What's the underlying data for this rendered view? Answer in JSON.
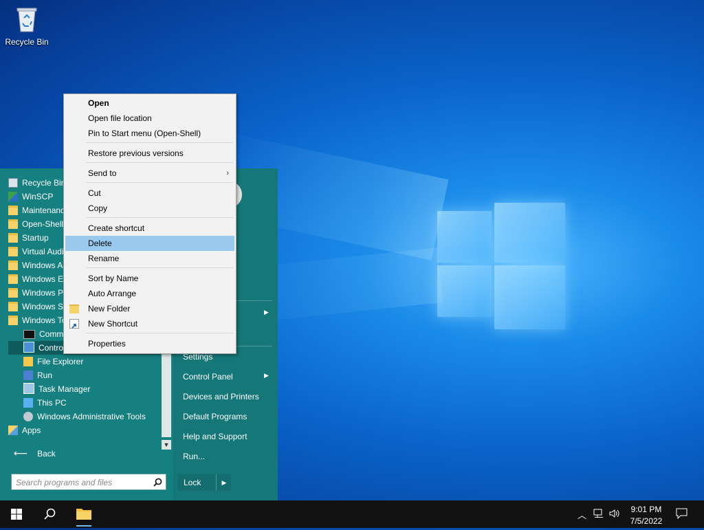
{
  "desktop": {
    "recycle_bin_label": "Recycle Bin"
  },
  "start_menu": {
    "programs": [
      {
        "label": "Recycle Bin",
        "icon": "recycle-bin-icon"
      },
      {
        "label": "WinSCP",
        "icon": "winscp-icon"
      },
      {
        "label": "Maintenance",
        "icon": "folder-icon"
      },
      {
        "label": "Open-Shell",
        "icon": "folder-icon"
      },
      {
        "label": "Startup",
        "icon": "folder-icon"
      },
      {
        "label": "Virtual Audio",
        "icon": "folder-icon"
      },
      {
        "label": "Windows Accessories",
        "icon": "folder-icon"
      },
      {
        "label": "Windows Ease of Access",
        "icon": "folder-icon"
      },
      {
        "label": "Windows PowerShell",
        "icon": "folder-icon"
      },
      {
        "label": "Windows System",
        "icon": "folder-icon"
      },
      {
        "label": "Windows Tools",
        "icon": "folder-icon"
      }
    ],
    "sub_programs": [
      {
        "label": "Command Prompt",
        "icon": "command-prompt-icon"
      },
      {
        "label": "Control Panel",
        "icon": "control-panel-icon"
      },
      {
        "label": "File Explorer",
        "icon": "file-explorer-icon"
      },
      {
        "label": "Run",
        "icon": "run-icon"
      },
      {
        "label": "Task Manager",
        "icon": "task-manager-icon"
      },
      {
        "label": "This PC",
        "icon": "this-pc-icon"
      },
      {
        "label": "Windows Administrative Tools",
        "icon": "admin-tools-icon"
      }
    ],
    "apps_label": "Apps",
    "back_label": "Back",
    "search_placeholder": "Search programs and files",
    "right_items": [
      {
        "label": "Settings"
      },
      {
        "label": "Control Panel",
        "has_submenu": true
      },
      {
        "label": "Devices and Printers"
      },
      {
        "label": "Default Programs"
      },
      {
        "label": "Help and Support"
      },
      {
        "label": "Run..."
      }
    ],
    "lock_label": "Lock"
  },
  "context_menu": {
    "items": [
      {
        "label": "Open",
        "bold": true
      },
      {
        "label": "Open file location"
      },
      {
        "label": "Pin to Start menu (Open-Shell)"
      },
      {
        "label": "Restore previous versions"
      },
      {
        "label": "Send to",
        "has_submenu": true
      },
      {
        "label": "Cut"
      },
      {
        "label": "Copy"
      },
      {
        "label": "Create shortcut"
      },
      {
        "label": "Delete",
        "highlighted": true
      },
      {
        "label": "Rename"
      },
      {
        "label": "Sort by Name"
      },
      {
        "label": "Auto Arrange"
      },
      {
        "label": "New Folder",
        "icon": "folder-icon"
      },
      {
        "label": "New Shortcut",
        "icon": "shortcut-icon"
      },
      {
        "label": "Properties"
      }
    ]
  },
  "taskbar": {
    "time": "9:01 PM",
    "date": "7/5/2022",
    "icons": [
      "windows-start-icon",
      "search-icon",
      "file-explorer-icon"
    ],
    "tray_icons": [
      "chevron-up-icon",
      "network-icon",
      "volume-icon",
      "notification-icon"
    ]
  },
  "colors": {
    "start_menu_bg": "#167f80",
    "menu_highlight": "#99c9ef",
    "taskbar_bg": "#121212"
  }
}
